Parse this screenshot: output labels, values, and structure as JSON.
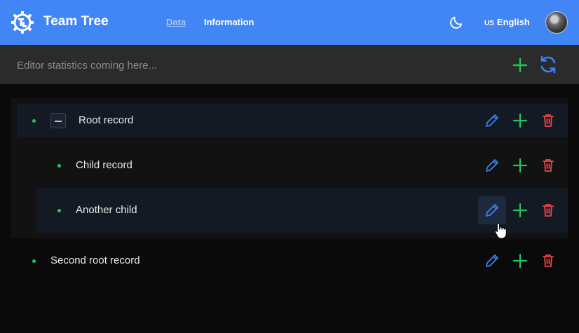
{
  "header": {
    "app_title": "Team Tree",
    "nav": {
      "data_label": "Data",
      "information_label": "Information"
    },
    "language": {
      "flag": "US",
      "label": "English"
    }
  },
  "stats": {
    "placeholder": "Editor statistics coming here..."
  },
  "tree": {
    "rows": [
      {
        "label": "Root record"
      },
      {
        "label": "Child record"
      },
      {
        "label": "Another child"
      },
      {
        "label": "Second root record"
      }
    ]
  },
  "colors": {
    "header": "#4285f4",
    "accent_green": "#22c55e",
    "edit_blue": "#3b82f6",
    "delete_red": "#ef4444"
  }
}
